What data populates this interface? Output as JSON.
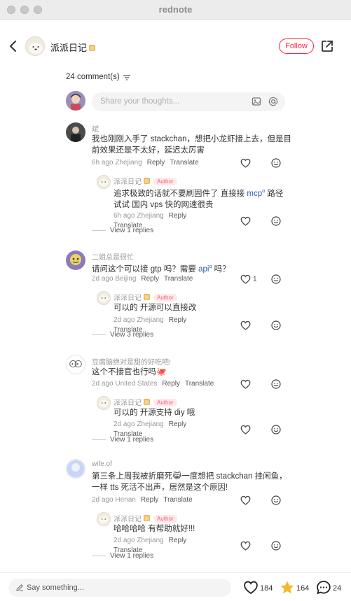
{
  "window": {
    "title": "rednote"
  },
  "header": {
    "author_name": "派派日记",
    "follow_label": "Follow"
  },
  "comments_header": {
    "count_label": "24 comment(s)"
  },
  "composer": {
    "placeholder": "Share your thoughts..."
  },
  "labels": {
    "reply": "Reply",
    "translate": "Translate",
    "author_tag": "Author"
  },
  "comments": [
    {
      "username": "斌",
      "text_line1": "我也刚刚入手了 stackchan，想把小龙虾接上去，但是目",
      "text_line2": "前效果还是不太好，延迟太厉害",
      "meta": "6h ago Zhejiang",
      "likes": "",
      "reply": {
        "username": "派派日记",
        "text_line1_a": "追求极致的话就不要刷固件了 直接接 ",
        "link": "mcp",
        "text_line1_b": " 路径",
        "text_line2": "试试 国内 vps 快的网速很贵",
        "meta": "6h ago Zhejiang"
      },
      "view_replies": "View 1 replies"
    },
    {
      "username": "二姐总是很忙",
      "text_line1_a": "请问这个可以接 gtp 吗？需要 ",
      "link": "api",
      "text_line1_b": " 吗？",
      "meta": "2d ago Beijing",
      "likes": "1",
      "reply": {
        "username": "派派日记",
        "text_line1": "可以的 开源可以直接改",
        "meta": "2d ago Zhejiang"
      },
      "view_replies": "View 3 replies"
    },
    {
      "username": "豆腐脑绝对是甜的好吃吧!",
      "text_line1": "这个不接官也行吗🐙",
      "meta": "2d ago United States",
      "likes": "",
      "reply": {
        "username": "派派日记",
        "text_line1": "可以的 开源支持 diy 哦",
        "meta": "2d ago Zhejiang"
      },
      "view_replies": "View 1 replies"
    },
    {
      "username": "wife.of",
      "text_line1": "第三条上周我被折磨死😹一度想把 stackchan 挂闲鱼，",
      "text_line2": "一样 tts 死活不出声，居然是这个原因!",
      "meta": "2d ago Henan",
      "likes": "",
      "reply": {
        "username": "派派日记",
        "text_line1": "哈哈哈哈 有帮助就好!!!",
        "meta": "2d ago Zhejiang"
      },
      "view_replies": "View 1 replies"
    }
  ],
  "bottom_bar": {
    "say_placeholder": "Say something...",
    "likes": "184",
    "collects": "164",
    "comments": "24"
  },
  "colors": {
    "accent": "#ff2442",
    "star": "#f5b82e",
    "link": "#2a5db0"
  },
  "icons": [
    "back-arrow-icon",
    "share-icon",
    "sort-icon",
    "image-icon",
    "at-icon",
    "heart-icon",
    "smile-icon",
    "pencil-icon",
    "star-icon",
    "comment-bubble-icon"
  ]
}
